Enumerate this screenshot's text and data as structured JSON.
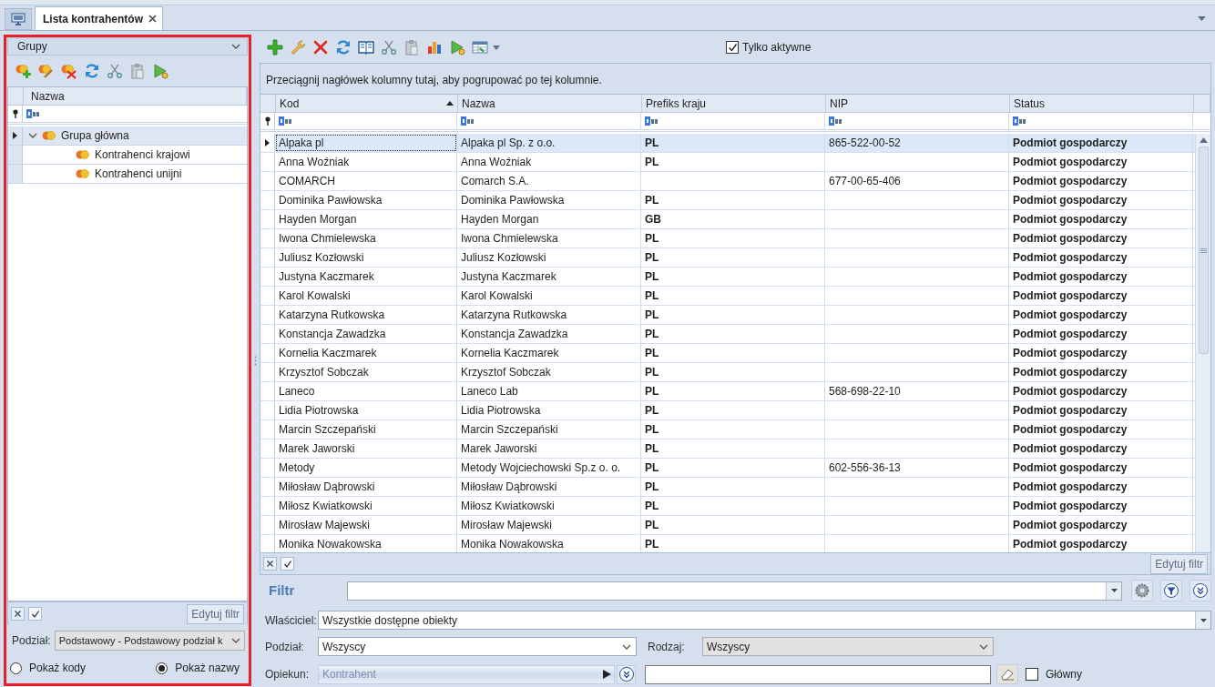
{
  "tab": {
    "title": "Lista kontrahentów",
    "selected": true
  },
  "groups": {
    "title": "Grupy",
    "tree_column": "Nazwa",
    "tree": [
      {
        "label": "Grupa główna",
        "expanded": true,
        "selected": true,
        "children": [
          {
            "label": "Kontrahenci krajowi",
            "selected": false
          },
          {
            "label": "Kontrahenci unijni",
            "selected": false
          }
        ]
      }
    ],
    "filter_enabled": true,
    "edit_filter_button": "Edytuj filtr",
    "division": {
      "label": "Podział:",
      "value": "Podstawowy - Podstawowy podział k"
    },
    "display_options": [
      {
        "label": "Pokaż kody",
        "selected": false
      },
      {
        "label": "Pokaż nazwy",
        "selected": true
      }
    ]
  },
  "list": {
    "only_active": {
      "label": "Tylko aktywne",
      "checked": true
    },
    "group_hint": "Przeciągnij nagłówek kolumny tutaj, aby pogrupować po tej kolumnie.",
    "columns": [
      {
        "label": "Kod",
        "sorted_ascending": true
      },
      {
        "label": "Nazwa"
      },
      {
        "label": "Prefiks kraju"
      },
      {
        "label": "NIP"
      },
      {
        "label": "Status"
      }
    ],
    "rows": [
      {
        "code": "Alpaka pl",
        "name": "Alpaka pl Sp. z o.o.",
        "country_prefix": "PL",
        "nip": "865-522-00-52",
        "status": "Podmiot gospodarczy",
        "selected": true
      },
      {
        "code": "Anna Woźniak",
        "name": "Anna Woźniak",
        "country_prefix": "PL",
        "status": "Podmiot gospodarczy",
        "selected": false
      },
      {
        "code": "COMARCH",
        "name": "Comarch S.A.",
        "nip": "677-00-65-406",
        "status": "Podmiot gospodarczy",
        "selected": false
      },
      {
        "code": "Dominika Pawłowska",
        "name": "Dominika Pawłowska",
        "country_prefix": "PL",
        "status": "Podmiot gospodarczy",
        "selected": false
      },
      {
        "code": "Hayden Morgan",
        "name": "Hayden Morgan",
        "country_prefix": "GB",
        "status": "Podmiot gospodarczy",
        "selected": false
      },
      {
        "code": "Iwona Chmielewska",
        "name": "Iwona Chmielewska",
        "country_prefix": "PL",
        "status": "Podmiot gospodarczy",
        "selected": false
      },
      {
        "code": "Juliusz Kozłowski",
        "name": "Juliusz Kozłowski",
        "country_prefix": "PL",
        "status": "Podmiot gospodarczy",
        "selected": false
      },
      {
        "code": "Justyna Kaczmarek",
        "name": "Justyna Kaczmarek",
        "country_prefix": "PL",
        "status": "Podmiot gospodarczy",
        "selected": false
      },
      {
        "code": "Karol Kowalski",
        "name": "Karol Kowalski",
        "country_prefix": "PL",
        "status": "Podmiot gospodarczy",
        "selected": false
      },
      {
        "code": "Katarzyna Rutkowska",
        "name": "Katarzyna Rutkowska",
        "country_prefix": "PL",
        "status": "Podmiot gospodarczy",
        "selected": false
      },
      {
        "code": "Konstancja Zawadzka",
        "name": "Konstancja Zawadzka",
        "country_prefix": "PL",
        "status": "Podmiot gospodarczy",
        "selected": false
      },
      {
        "code": "Kornelia Kaczmarek",
        "name": "Kornelia Kaczmarek",
        "country_prefix": "PL",
        "status": "Podmiot gospodarczy",
        "selected": false
      },
      {
        "code": "Krzysztof Sobczak",
        "name": "Krzysztof Sobczak",
        "country_prefix": "PL",
        "status": "Podmiot gospodarczy",
        "selected": false
      },
      {
        "code": "Laneco",
        "name": "Laneco Lab",
        "country_prefix": "PL",
        "nip": "568-698-22-10",
        "status": "Podmiot gospodarczy",
        "selected": false
      },
      {
        "code": "Lidia Piotrowska",
        "name": "Lidia Piotrowska",
        "country_prefix": "PL",
        "status": "Podmiot gospodarczy",
        "selected": false
      },
      {
        "code": "Marcin Szczepański",
        "name": "Marcin Szczepański",
        "country_prefix": "PL",
        "status": "Podmiot gospodarczy",
        "selected": false
      },
      {
        "code": "Marek Jaworski",
        "name": "Marek Jaworski",
        "country_prefix": "PL",
        "status": "Podmiot gospodarczy",
        "selected": false
      },
      {
        "code": "Metody",
        "name": "Metody Wojciechowski Sp.z o. o.",
        "country_prefix": "PL",
        "nip": "602-556-36-13",
        "status": "Podmiot gospodarczy",
        "selected": false
      },
      {
        "code": "Miłosław Dąbrowski",
        "name": "Miłosław Dąbrowski",
        "country_prefix": "PL",
        "status": "Podmiot gospodarczy",
        "selected": false
      },
      {
        "code": "Miłosz Kwiatkowski",
        "name": "Miłosz Kwiatkowski",
        "country_prefix": "PL",
        "status": "Podmiot gospodarczy",
        "selected": false
      },
      {
        "code": "Mirosław Majewski",
        "name": "Mirosław Majewski",
        "country_prefix": "PL",
        "status": "Podmiot gospodarczy",
        "selected": false
      },
      {
        "code": "Monika Nowakowska",
        "name": "Monika Nowakowska",
        "country_prefix": "PL",
        "status": "Podmiot gospodarczy",
        "selected": false
      }
    ],
    "filter_enabled": true,
    "edit_filter_button": "Edytuj filtr"
  },
  "filter": {
    "label": "Filtr",
    "owner": {
      "label": "Właściciel:",
      "value": "Wszystkie dostępne obiekty"
    },
    "division": {
      "label": "Podział:",
      "value": "Wszyscy"
    },
    "kind_field": {
      "label": "Rodzaj:",
      "value": "Wszyscy",
      "disabled": true
    },
    "caretaker": {
      "label": "Opiekun:",
      "selector": "Kontrahent"
    },
    "main_only": {
      "label": "Główny",
      "checked": false
    }
  }
}
